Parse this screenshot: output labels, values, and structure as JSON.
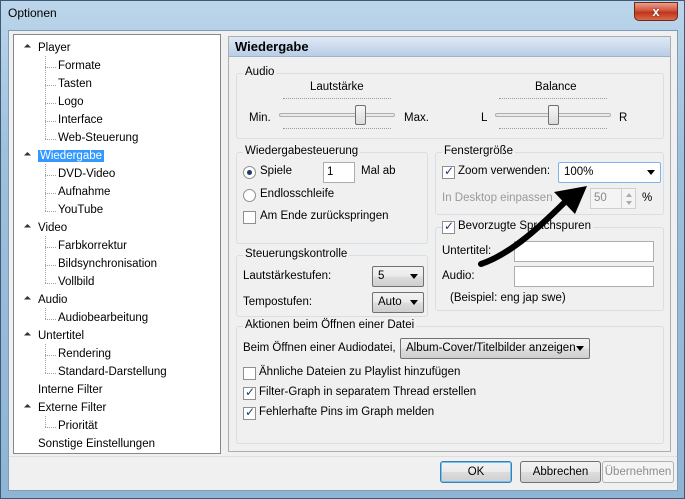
{
  "window": {
    "title": "Optionen",
    "close_glyph": "x"
  },
  "tree": [
    {
      "label": "Player",
      "level": 0,
      "expander": true
    },
    {
      "label": "Formate",
      "level": 1
    },
    {
      "label": "Tasten",
      "level": 1
    },
    {
      "label": "Logo",
      "level": 1
    },
    {
      "label": "Interface",
      "level": 1
    },
    {
      "label": "Web-Steuerung",
      "level": 1
    },
    {
      "label": "Wiedergabe",
      "level": 0,
      "expander": true,
      "selected": true
    },
    {
      "label": "DVD-Video",
      "level": 1
    },
    {
      "label": "Aufnahme",
      "level": 1
    },
    {
      "label": "YouTube",
      "level": 1
    },
    {
      "label": "Video",
      "level": 0,
      "expander": true
    },
    {
      "label": "Farbkorrektur",
      "level": 1
    },
    {
      "label": "Bildsynchronisation",
      "level": 1
    },
    {
      "label": "Vollbild",
      "level": 1
    },
    {
      "label": "Audio",
      "level": 0,
      "expander": true
    },
    {
      "label": "Audiobearbeitung",
      "level": 1
    },
    {
      "label": "Untertitel",
      "level": 0,
      "expander": true
    },
    {
      "label": "Rendering",
      "level": 1
    },
    {
      "label": "Standard-Darstellung",
      "level": 1
    },
    {
      "label": "Interne Filter",
      "level": 0
    },
    {
      "label": "Externe Filter",
      "level": 0,
      "expander": true
    },
    {
      "label": "Priorität",
      "level": 1
    },
    {
      "label": "Sonstige Einstellungen",
      "level": 0
    }
  ],
  "panel": {
    "header": "Wiedergabe",
    "audio": {
      "title": "Audio",
      "volume_label": "Lautstärke",
      "volume_min": "Min.",
      "volume_max": "Max.",
      "volume_value": 0.72,
      "balance_label": "Balance",
      "balance_left": "L",
      "balance_right": "R",
      "balance_value": 0.5
    },
    "playback": {
      "title": "Wiedergabesteuerung",
      "repeat_label": "Spiele",
      "repeat_count": "1",
      "repeat_suffix": "Mal ab",
      "loop_label": "Endlosschleife",
      "rewind_label": "Am Ende zurückspringen"
    },
    "window_size": {
      "title": "Fenstergröße",
      "zoom_label": "Zoom verwenden:",
      "zoom_value": "100%",
      "fit_label": "In Desktop einpassen",
      "fit_value": "50",
      "fit_unit": "%"
    },
    "languages": {
      "title": "Bevorzugte Sprachspuren",
      "subtitle_label": "Untertitel:",
      "audio_label": "Audio:",
      "example": "(Beispiel: eng jap swe)"
    },
    "controls": {
      "title": "Steuerungskontrolle",
      "volume_steps_label": "Lautstärkestufen:",
      "volume_steps_value": "5",
      "speed_steps_label": "Tempostufen:",
      "speed_steps_value": "Auto"
    },
    "file_actions": {
      "title": "Aktionen beim Öffnen einer Datei",
      "audio_open_label": "Beim Öffnen einer Audiodatei,",
      "audio_open_value": "Album-Cover/Titelbilder anzeigen",
      "similar_files_label": "Ähnliche Dateien zu Playlist hinzufügen",
      "filter_thread_label": "Filter-Graph in separatem Thread erstellen",
      "broken_pins_label": "Fehlerhafte Pins im Graph melden"
    }
  },
  "buttons": {
    "ok": "OK",
    "cancel": "Abbrechen",
    "apply": "Übernehmen"
  },
  "colors": {
    "selection": "#3399ff",
    "accent": "#1c3c6e"
  }
}
